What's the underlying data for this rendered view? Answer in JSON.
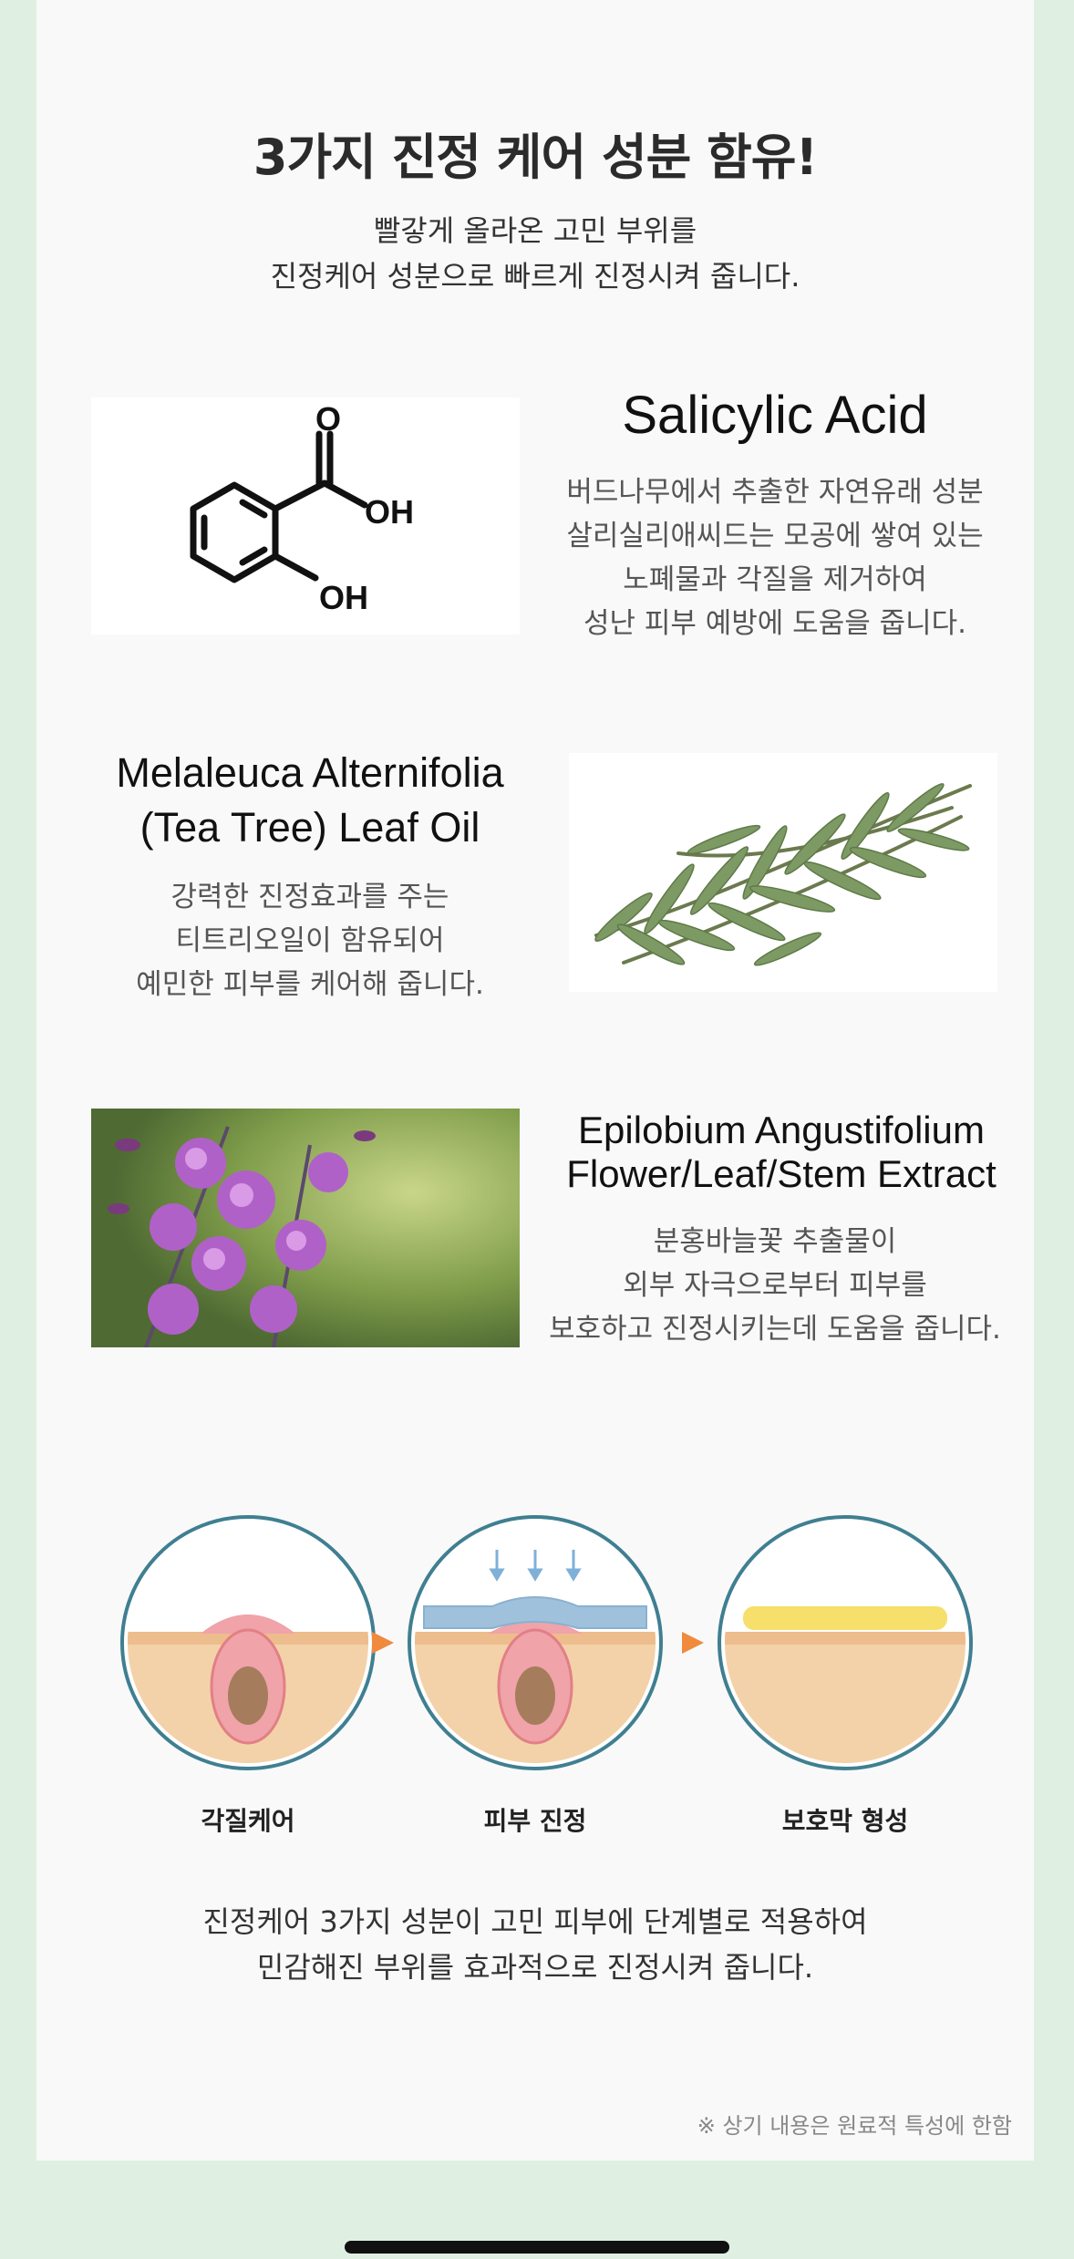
{
  "header": {
    "title": "3가지 진정 케어 성분 함유!",
    "subtitle_lines": [
      "빨갛게 올라온 고민 부위를",
      "진정케어 성분으로 빠르게 진정시켜 줍니다."
    ]
  },
  "ingredients": [
    {
      "name": "Salicylic Acid",
      "structure_labels": {
        "carbonyl_o": "O",
        "acid_oh": "OH",
        "phenol_oh": "OH"
      },
      "desc_lines": [
        "버드나무에서 추출한 자연유래 성분",
        "살리실리애씨드는 모공에 쌓여 있는",
        "노폐물과 각질을 제거하여",
        "성난 피부 예방에 도움을 줍니다."
      ]
    },
    {
      "name_lines": [
        "Melaleuca Alternifolia",
        "(Tea Tree) Leaf Oil"
      ],
      "desc_lines": [
        "강력한 진정효과를 주는",
        "티트리오일이 함유되어",
        "예민한 피부를 케어해 줍니다."
      ]
    },
    {
      "name_lines": [
        "Epilobium Angustifolium",
        "Flower/Leaf/Stem Extract"
      ],
      "desc_lines": [
        "분홍바늘꽃 추출물이",
        "외부 자극으로부터 피부를",
        "보호하고 진정시키는데 도움을 줍니다."
      ]
    }
  ],
  "stages": [
    {
      "label": "각질케어"
    },
    {
      "label": "피부 진정"
    },
    {
      "label": "보호막 형성"
    }
  ],
  "footer": {
    "lines": [
      "진정케어 3가지 성분이 고민 피부에 단계별로 적용하여",
      "민감해진  부위를 효과적으로 진정시켜 줍니다."
    ],
    "note": "※ 상기 내용은 원료적 특성에 한함"
  },
  "colors": {
    "background": "#dff0e2",
    "page": "#f9f9f9",
    "circle_border": "#3f7f91",
    "arrow": "#f08a3c",
    "skin": "#f3d2a9",
    "calming_layer": "#9fc1dc",
    "protective_layer": "#f6df6b",
    "pore": "#f0a3a8"
  }
}
